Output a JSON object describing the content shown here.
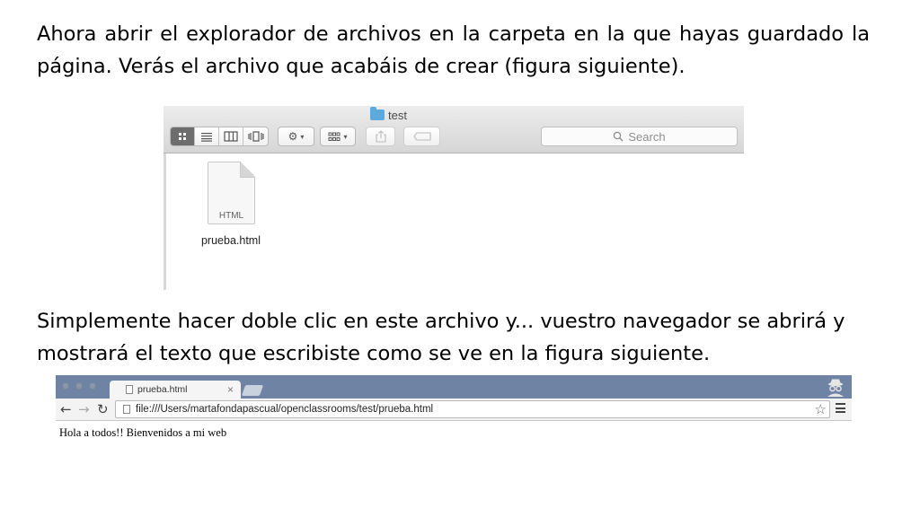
{
  "slide": {
    "paragraph_1": "Ahora abrir el explorador de archivos en la carpeta en la que hayas guardado la página. Verás el archivo que acabáis de crear (figura siguiente).",
    "paragraph_2": "Simplemente hacer doble clic en este archivo y... vuestro navegador se abrirá y mostrará el texto que escribiste como se ve en la figura siguiente."
  },
  "finder": {
    "window_title": "test",
    "search_placeholder": "Search",
    "file": {
      "name": "prueba.html",
      "extension_label": "HTML"
    },
    "toolbar": {
      "view_buttons": [
        "icon-view",
        "list-view",
        "column-view",
        "cover-flow-view"
      ],
      "active_view": "icon-view"
    }
  },
  "browser": {
    "tab_title": "prueba.html",
    "tab_close": "×",
    "url": "file:///Users/martafondapascual/openclassrooms/test/prueba.html",
    "page_text": "Hola a todos!! Bienvenidos a mi web",
    "icons": {
      "back": "←",
      "forward": "→",
      "reload": "↻",
      "bookmark": "☆"
    }
  },
  "colors": {
    "browser_tabstrip": "#6f84a5",
    "finder_folder": "#5ea9dc"
  }
}
